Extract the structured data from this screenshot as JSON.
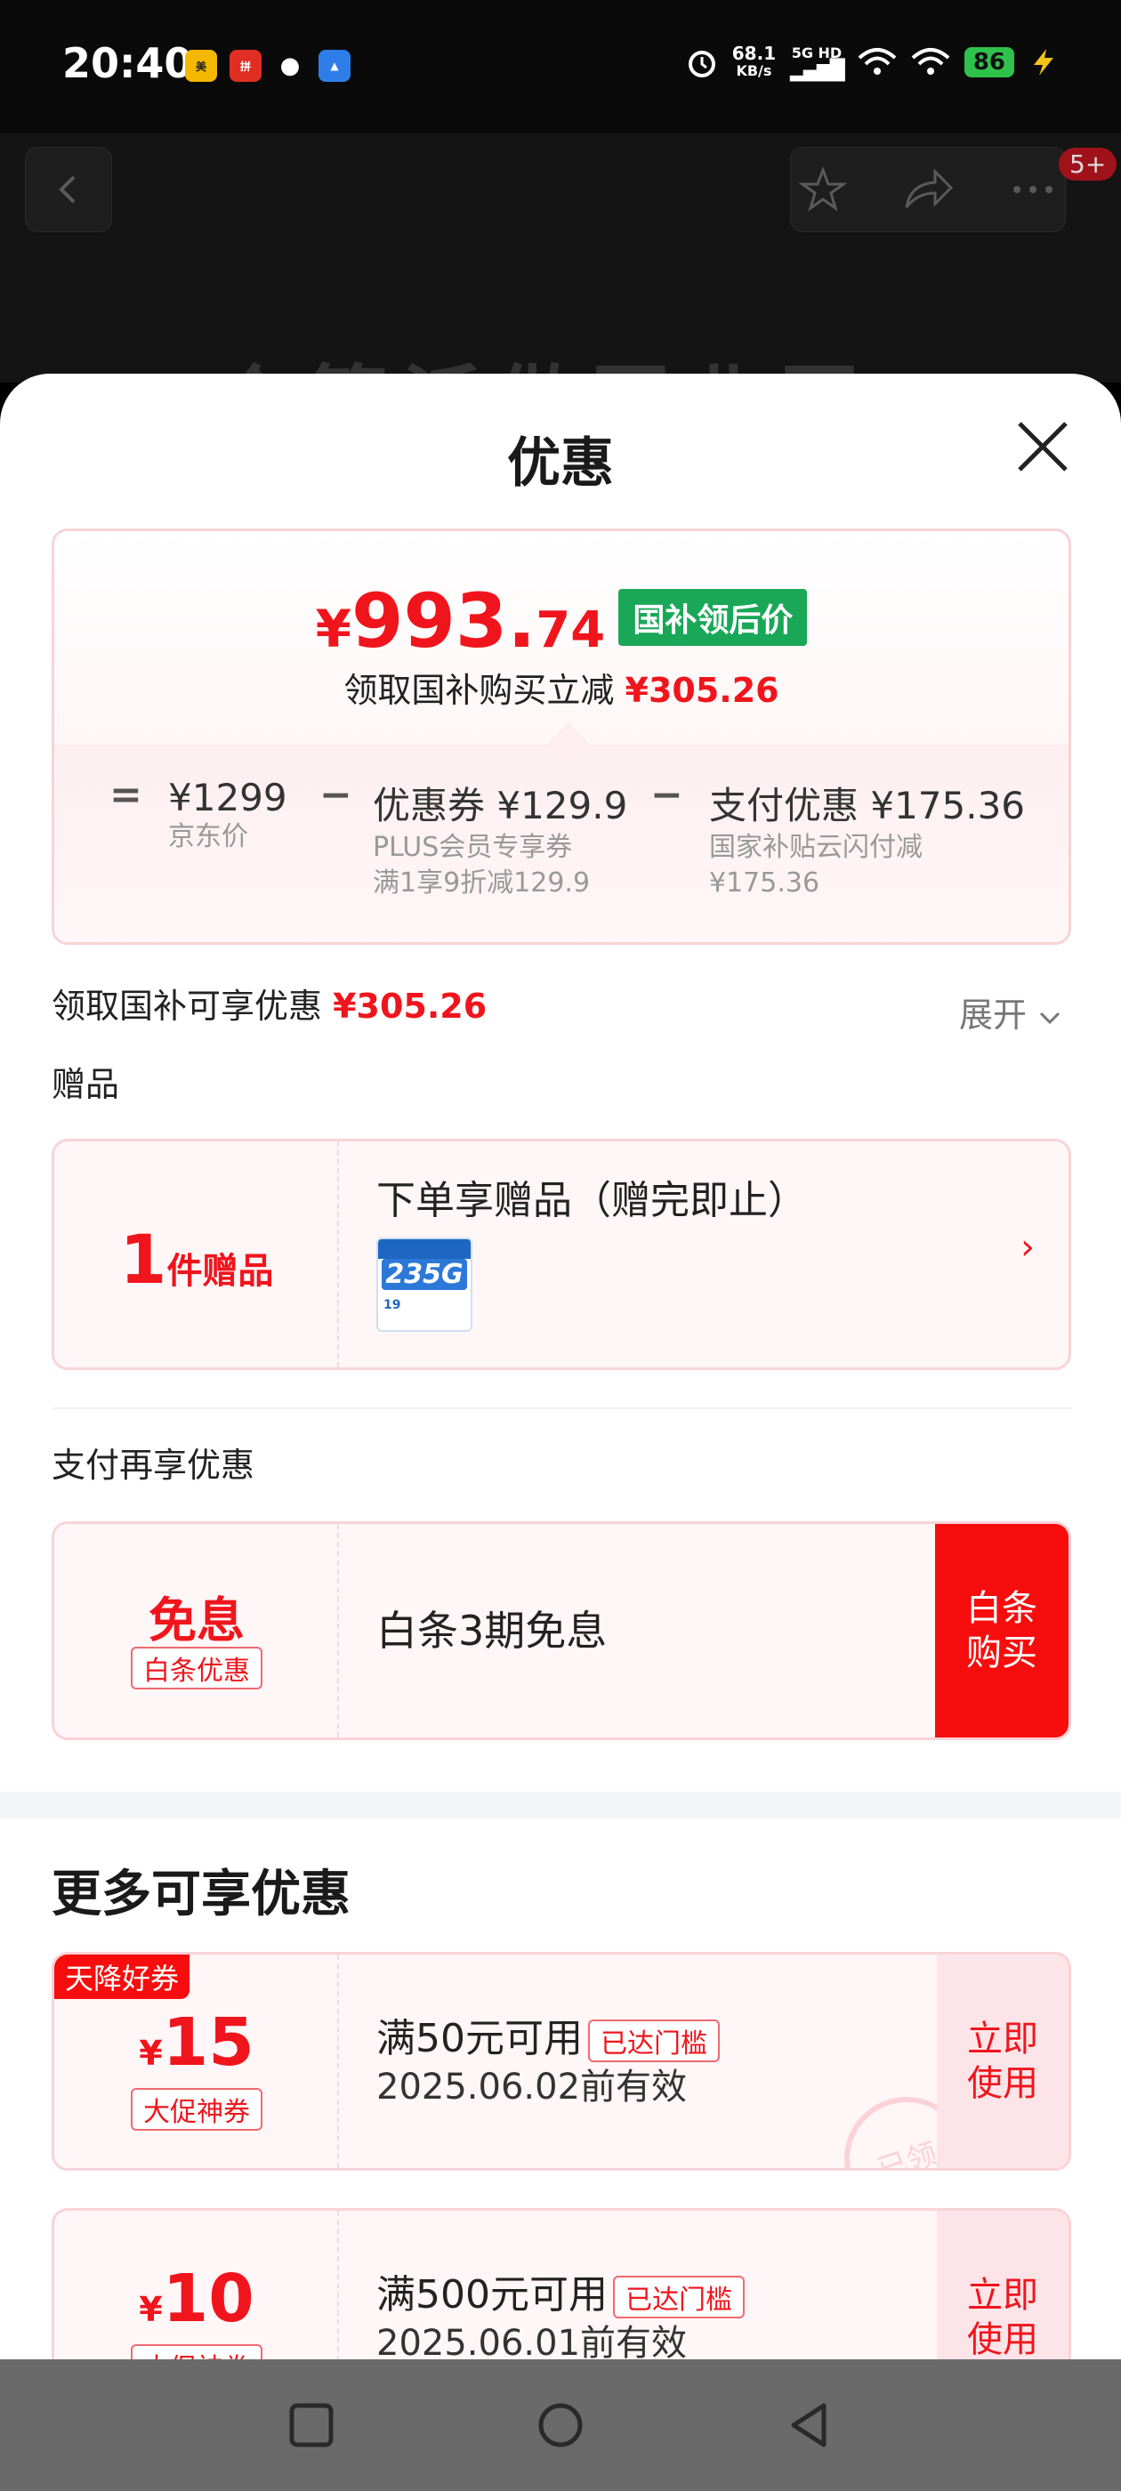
{
  "status_bar": {
    "time": "20:40",
    "network_speed": "68.1",
    "network_unit": "KB/s",
    "signal_label": "5G HD",
    "battery": "86",
    "app_icons": [
      "meituan-icon",
      "pinduoduo-icon",
      "wechat-icon",
      "maps-icon"
    ]
  },
  "background_page": {
    "title_fragment": "个簇派做国北国",
    "notification_badge": "5+"
  },
  "sheet": {
    "title": "优惠",
    "price_card": {
      "currency": "¥",
      "price_int": "993.",
      "price_dec": "74",
      "price_tag": "国补领后价",
      "subtitle_prefix": "领取国补购买立减",
      "subtitle_amount": "¥305.26",
      "breakdown": {
        "equals": "=",
        "minus": "−",
        "jd_price_value": "¥1299",
        "jd_price_label": "京东价",
        "coupon_value": "优惠券 ¥129.9",
        "coupon_desc_1": "PLUS会员专享券",
        "coupon_desc_2": "满1享9折减129.9",
        "pay_value": "支付优惠 ¥175.36",
        "pay_desc_1": "国家补贴云闪付减",
        "pay_desc_2": "¥175.36"
      }
    },
    "subsidy_row": {
      "label": "领取国补可享优惠",
      "amount": "¥305.26",
      "expand_label": "展开"
    },
    "gift_section": {
      "label": "赠品",
      "count": "1",
      "count_unit": "件赠品",
      "title": "下单享赠品（赠完即止）",
      "thumb_text": "235G",
      "thumb_price": "19"
    },
    "payment_section": {
      "label": "支付再享优惠",
      "highlight": "免息",
      "tag": "白条优惠",
      "text": "白条3期免息",
      "button_line1": "白条",
      "button_line2": "购买"
    },
    "more_section": {
      "title": "更多可享优惠",
      "coupons": [
        {
          "corner_tag": "天降好券",
          "currency": "¥",
          "amount": "15",
          "type_tag": "大促神券",
          "condition": "满50元可用",
          "status_tag": "已达门槛",
          "validity": "2025.06.02前有效",
          "button_line1": "立即",
          "button_line2": "使用",
          "stamp": "已领"
        },
        {
          "corner_tag": "",
          "currency": "¥",
          "amount": "10",
          "type_tag": "大促神券",
          "condition": "满500元可用",
          "status_tag": "已达门槛",
          "validity": "2025.06.01前有效",
          "button_line1": "立即",
          "button_line2": "使用",
          "stamp": ""
        }
      ]
    }
  },
  "colors": {
    "accent_red": "#f0151c",
    "button_red": "#f70d0d",
    "tag_green": "#1aa858",
    "card_border": "#f8d3d8",
    "card_bg": "#fff6f7"
  }
}
